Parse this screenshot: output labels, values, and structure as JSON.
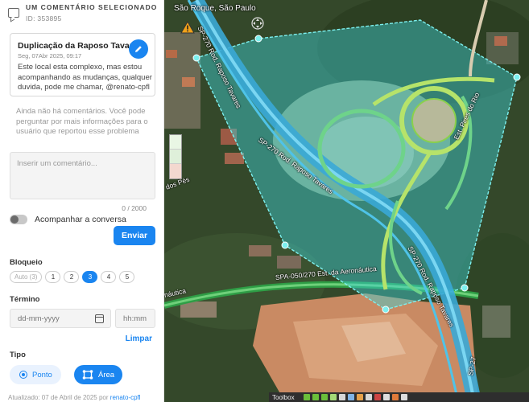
{
  "panel": {
    "header_title": "UM COMENTÁRIO SELECIONADO",
    "header_id": "ID: 353895",
    "card": {
      "title": "Duplicação da Raposo Tavares",
      "date": "Seg, 07Abr 2025, 09:17",
      "body": "Este local esta complexo, mas estou acompanhando as mudanças, qualquer duvida, pode me chamar, @renato-cpfl"
    },
    "no_comments": "Ainda não há comentários. Você pode perguntar por mais informações para o usuário que reportou esse problema",
    "comment_placeholder": "Inserir um comentário...",
    "counter": "0 / 2000",
    "follow_label": "Acompanhar a conversa",
    "send_label": "Enviar",
    "block_label": "Bloqueio",
    "block_options": [
      "Auto (3)",
      "1",
      "2",
      "3",
      "4",
      "5"
    ],
    "block_selected": "3",
    "end_label": "Término",
    "date_placeholder": "dd-mm-yyyy",
    "time_placeholder": "hh:mm",
    "clear_label": "Limpar",
    "type_label": "Tipo",
    "type_point": "Ponto",
    "type_area": "Área",
    "footer_prefix": "Atualizado: 07 de Abril de 2025 por",
    "footer_user": "renato-cpfl"
  },
  "map": {
    "place": "São Roque, São Paulo",
    "road_labels": {
      "sp270_top": "SP-270 Rod. Raposo Tavares",
      "sp270_mid": "SP-270 Rod. Raposo Tavares",
      "sp270_bot": "SP-270 Rod. Raposo Tavares",
      "spa050": "SPA-050/270 Est. da Aeronáutica",
      "estrada": "Est. Pires do Rio",
      "aeronautica_left": "náutica",
      "dos_pes": "dos Pés",
      "sp_right": "SP-27"
    },
    "toolbar_label": "Toolbox",
    "colors": {
      "polygon_fill": "#3fd3d8",
      "polygon_stroke": "#7df0ef",
      "highway": "#4fc3e8",
      "ramp": "#b6e36a",
      "accent": "#1a85f0"
    }
  }
}
